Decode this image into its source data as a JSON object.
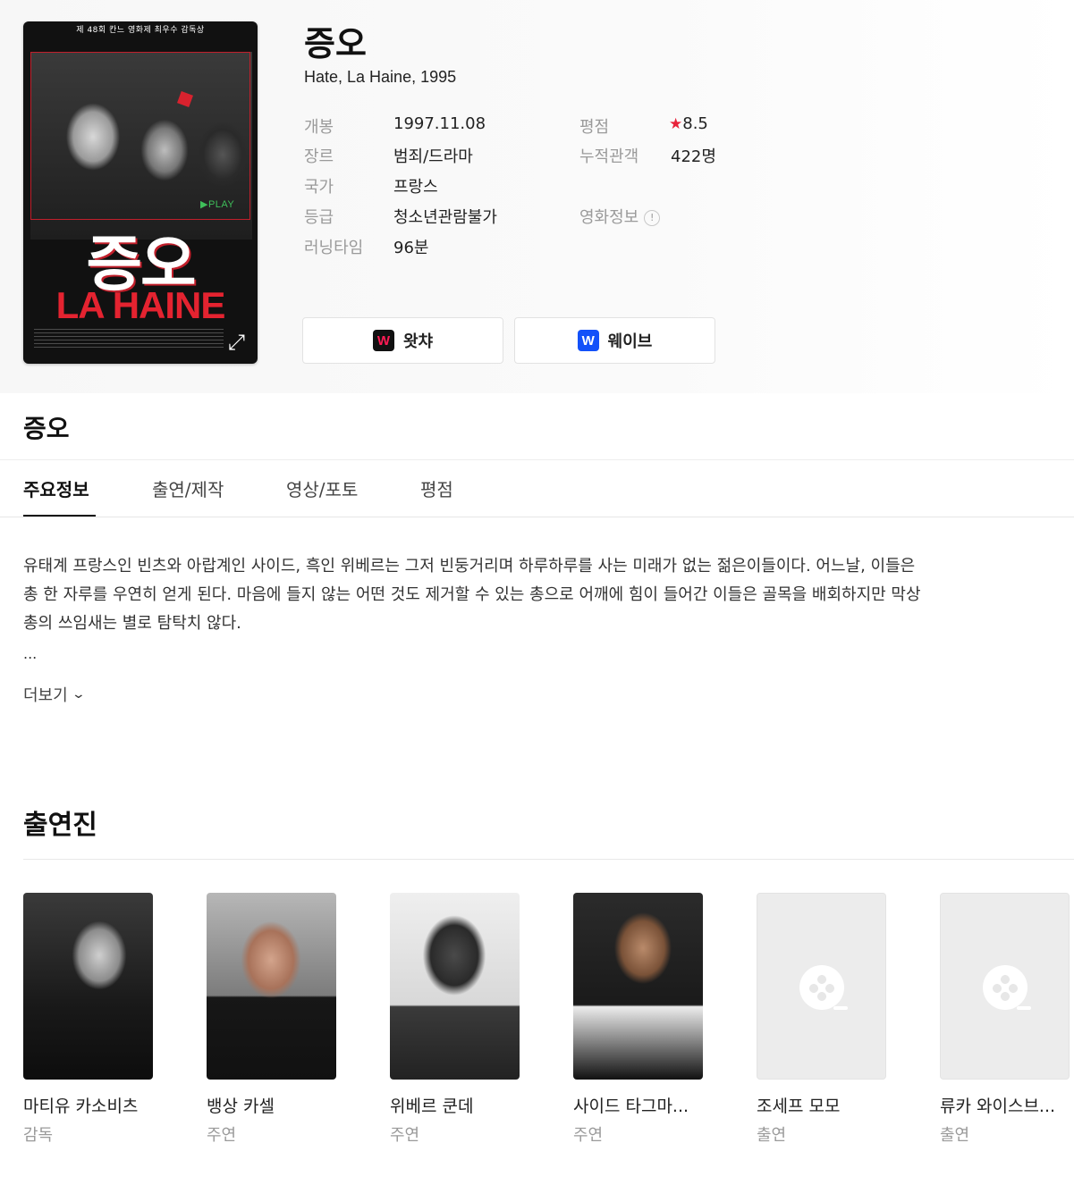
{
  "movie": {
    "title": "증오",
    "original": "Hate, La Haine, 1995",
    "poster": {
      "top_text": "제 48회 칸느 영화제 최우수 감독상",
      "big_title": "증오",
      "subtitle": "LA HAINE",
      "play": "▶PLAY"
    },
    "info": {
      "release_label": "개봉",
      "release_value": "1997.11.08",
      "genre_label": "장르",
      "genre_value": "범죄/드라마",
      "country_label": "국가",
      "country_value": "프랑스",
      "rating_label": "등급",
      "rating_value": "청소년관람불가",
      "runtime_label": "러닝타임",
      "runtime_value": "96분",
      "score_label": "평점",
      "score_value": "8.5",
      "audience_label": "누적관객",
      "audience_value": "422명",
      "movieinfo_label": "영화정보"
    }
  },
  "ott": [
    {
      "label": "왓챠",
      "icon": "W"
    },
    {
      "label": "웨이브",
      "icon": "W"
    }
  ],
  "section_title": "증오",
  "tabs": [
    "주요정보",
    "출연/제작",
    "영상/포토",
    "평점"
  ],
  "synopsis": "유태계 프랑스인 빈츠와 아랍계인 사이드, 흑인 위베르는 그저 빈둥거리며 하루하루를 사는 미래가 없는 젊은이들이다. 어느날, 이들은 총 한 자루를 우연히 얻게 된다. 마음에 들지 않는 어떤 것도 제거할 수 있는 총으로 어깨에 힘이 들어간 이들은 골목을 배회하지만 막상 총의 쓰임새는 별로 탐탁치 않다.",
  "ellipsis": "...",
  "more_label": "더보기",
  "cast_title": "출연진",
  "cast": [
    {
      "name": "마티유 카소비츠",
      "role": "감독"
    },
    {
      "name": "뱅상 카셀",
      "role": "주연"
    },
    {
      "name": "위베르 쿤데",
      "role": "주연"
    },
    {
      "name": "사이드 타그마...",
      "role": "주연"
    },
    {
      "name": "조세프 모모",
      "role": "출연"
    },
    {
      "name": "류카 와이스브...",
      "role": "출연"
    }
  ],
  "colors": {
    "star": "#e8223a",
    "watcha": "#ff1b55",
    "wavve": "#1351f9"
  }
}
